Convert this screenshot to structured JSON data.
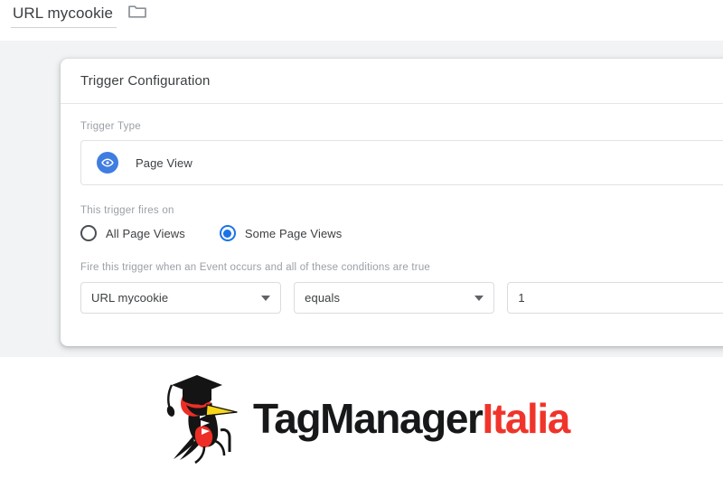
{
  "topbar": {
    "field_name": "URL mycookie",
    "folder_icon": "folder-icon"
  },
  "dialog": {
    "title": "Trigger Configuration",
    "trigger_type": {
      "label": "Trigger Type",
      "selected": "Page View",
      "icon": "eye-icon"
    },
    "fires_on": {
      "label": "This trigger fires on",
      "options": [
        {
          "label": "All Page Views",
          "selected": false
        },
        {
          "label": "Some Page Views",
          "selected": true
        }
      ]
    },
    "conditions": {
      "hint": "Fire this trigger when an Event occurs and all of these conditions are true",
      "rows": [
        {
          "variable": "URL mycookie",
          "operator": "equals",
          "value": "1",
          "value_placeholder": ""
        }
      ]
    }
  },
  "logo": {
    "text_primary": "TagManager",
    "text_accent": "Italia",
    "bird_icon": "woodpecker-graduate-icon"
  },
  "colors": {
    "accent_blue": "#1a73e8",
    "eye_badge_blue": "#3f7de0",
    "logo_red": "#f0342b",
    "logo_black": "#16181a",
    "workspace_gray": "#f1f3f4",
    "text_primary": "#3c4043",
    "text_muted": "#9aa0a6"
  }
}
